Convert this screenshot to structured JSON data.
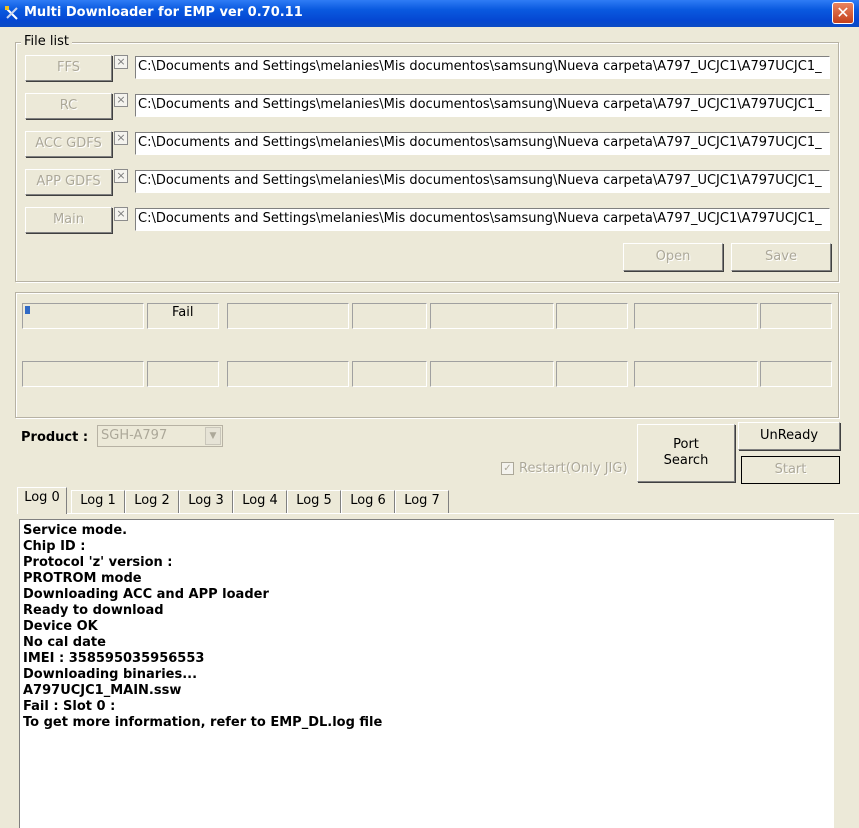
{
  "window": {
    "title": "Multi Downloader for EMP ver 0.70.11",
    "close_glyph": "✕"
  },
  "file_list": {
    "label": "File list",
    "rows": [
      {
        "button": "FFS",
        "path": "C:\\Documents and Settings\\melanies\\Mis documentos\\samsung\\Nueva carpeta\\A797_UCJC1\\A797UCJC1_"
      },
      {
        "button": "RC",
        "path": "C:\\Documents and Settings\\melanies\\Mis documentos\\samsung\\Nueva carpeta\\A797_UCJC1\\A797UCJC1_"
      },
      {
        "button": "ACC GDFS",
        "path": "C:\\Documents and Settings\\melanies\\Mis documentos\\samsung\\Nueva carpeta\\A797_UCJC1\\A797UCJC1_"
      },
      {
        "button": "APP GDFS",
        "path": "C:\\Documents and Settings\\melanies\\Mis documentos\\samsung\\Nueva carpeta\\A797_UCJC1\\A797UCJC1_"
      },
      {
        "button": "Main",
        "path": "C:\\Documents and Settings\\melanies\\Mis documentos\\samsung\\Nueva carpeta\\A797_UCJC1\\A797UCJC1_"
      }
    ],
    "open_label": "Open",
    "save_label": "Save"
  },
  "slots": {
    "slot0_status": "Fail"
  },
  "product": {
    "label": "Product :",
    "value": "SGH-A797"
  },
  "restart": {
    "label": "Restart(Only JIG)",
    "checked": true
  },
  "buttons": {
    "port_search_line1": "Port",
    "port_search_line2": "Search",
    "unready": "UnReady",
    "start": "Start"
  },
  "tabs": [
    "Log 0",
    "Log 1",
    "Log 2",
    "Log 3",
    "Log 4",
    "Log 5",
    "Log 6",
    "Log 7"
  ],
  "log_lines": [
    "Service mode.",
    "Chip ID :",
    "Protocol 'z' version :",
    "PROTROM mode",
    "Downloading ACC and APP loader",
    "Ready to download",
    "Device OK",
    "No cal date",
    "IMEI : 358595035956553",
    "Downloading binaries...",
    "A797UCJC1_MAIN.ssw",
    "Fail : Slot 0 :",
    "To get more information, refer to EMP_DL.log file"
  ]
}
